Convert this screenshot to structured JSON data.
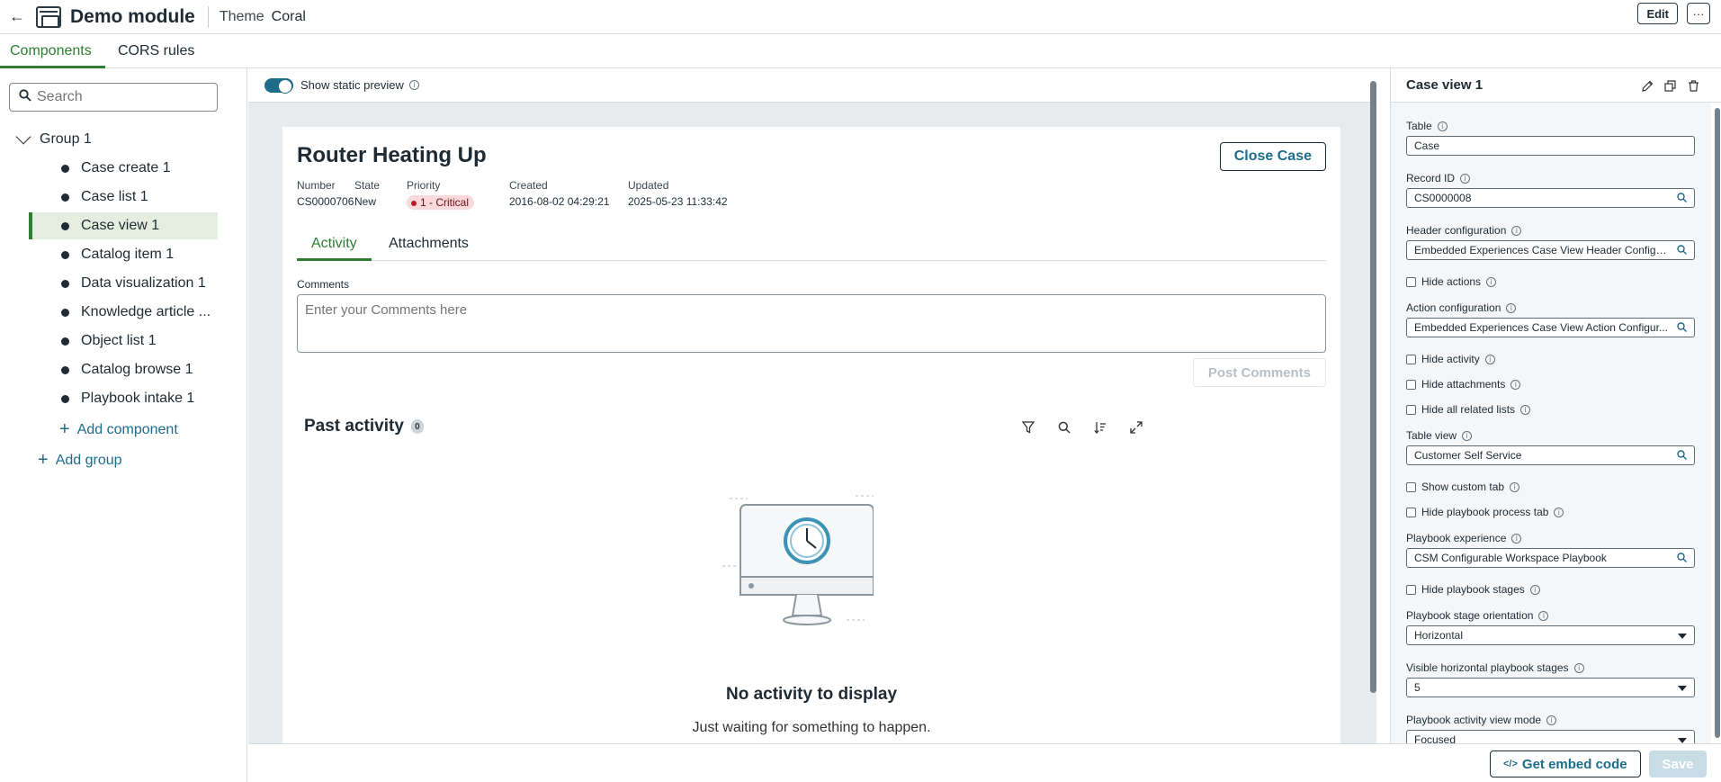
{
  "header": {
    "title": "Demo module",
    "theme_label": "Theme",
    "theme_value": "Coral",
    "edit_label": "Edit",
    "more_label": "···"
  },
  "tabs": [
    {
      "label": "Components",
      "active": true
    },
    {
      "label": "CORS rules",
      "active": false
    }
  ],
  "sidebar": {
    "search_placeholder": "Search",
    "group_label": "Group 1",
    "items": [
      {
        "label": "Case create 1"
      },
      {
        "label": "Case list 1"
      },
      {
        "label": "Case view 1",
        "active": true
      },
      {
        "label": "Catalog item 1"
      },
      {
        "label": "Data visualization 1"
      },
      {
        "label": "Knowledge article ..."
      },
      {
        "label": "Object list 1"
      },
      {
        "label": "Catalog browse 1"
      },
      {
        "label": "Playbook intake 1"
      }
    ],
    "add_component": "Add component",
    "add_group": "Add group"
  },
  "preview": {
    "toggle_label": "Show static preview",
    "case_title": "Router Heating Up",
    "close_case": "Close Case",
    "meta": {
      "number_k": "Number",
      "number_v": "CS0000706",
      "state_k": "State",
      "state_v": "New",
      "priority_k": "Priority",
      "priority_v": "1 - Critical",
      "created_k": "Created",
      "created_v": "2016-08-02 04:29:21",
      "updated_k": "Updated",
      "updated_v": "2025-05-23 11:33:42"
    },
    "tab_activity": "Activity",
    "tab_attachments": "Attachments",
    "comments_label": "Comments",
    "comments_placeholder": "Enter your Comments here",
    "post_comments": "Post Comments",
    "past_activity": "Past activity",
    "past_count": "0",
    "empty_title": "No activity to display",
    "empty_sub": "Just waiting for something to happen."
  },
  "panel": {
    "title": "Case view 1",
    "table_label": "Table",
    "table_value": "Case",
    "record_label": "Record ID",
    "record_value": "CS0000008",
    "header_cfg_label": "Header configuration",
    "header_cfg_value": "Embedded Experiences Case View Header Configu...",
    "hide_actions": "Hide actions",
    "action_cfg_label": "Action configuration",
    "action_cfg_value": "Embedded Experiences Case View Action Configur...",
    "hide_activity": "Hide activity",
    "hide_attachments": "Hide attachments",
    "hide_related": "Hide all related lists",
    "table_view_label": "Table view",
    "table_view_value": "Customer Self Service",
    "show_custom_tab": "Show custom tab",
    "hide_playbook_tab": "Hide playbook process tab",
    "playbook_exp_label": "Playbook experience",
    "playbook_exp_value": "CSM Configurable Workspace Playbook",
    "hide_playbook_stages": "Hide playbook stages",
    "stage_orient_label": "Playbook stage orientation",
    "stage_orient_value": "Horizontal",
    "visible_stages_label": "Visible horizontal playbook stages",
    "visible_stages_value": "5",
    "activity_mode_label": "Playbook activity view mode",
    "activity_mode_value": "Focused"
  },
  "footer": {
    "embed_label": "Get embed code",
    "save_label": "Save"
  },
  "colors": {
    "accent_green": "#2e7d32",
    "link_blue": "#1d6c8a",
    "critical_red": "#b91c2a"
  }
}
